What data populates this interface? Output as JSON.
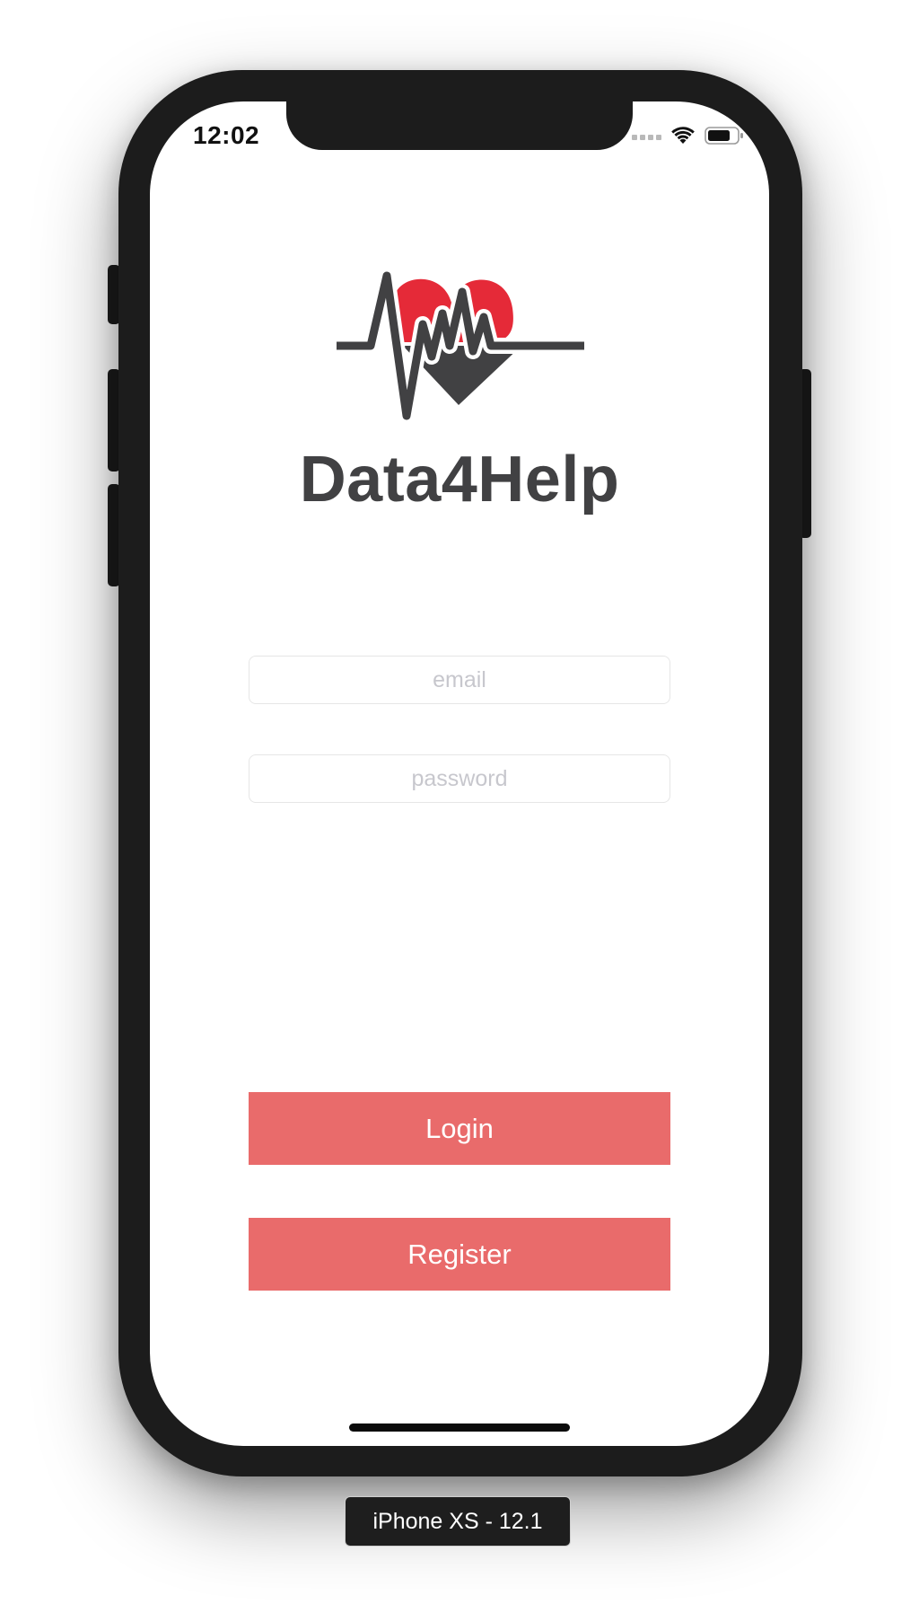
{
  "status_bar": {
    "time": "12:02",
    "icons": [
      "signal-dots-icon",
      "wifi-icon",
      "battery-icon"
    ]
  },
  "app": {
    "logo_icon": "heartbeat-heart-icon",
    "title": "Data4Help"
  },
  "form": {
    "email_placeholder": "email",
    "password_placeholder": "password"
  },
  "buttons": {
    "login_label": "Login",
    "register_label": "Register"
  },
  "device": {
    "label": "iPhone XS - 12.1"
  },
  "colors": {
    "accent": "#e96b6b",
    "logo_red": "#e52a38",
    "logo_dark": "#414143",
    "phone_frame": "#1c1c1c"
  }
}
